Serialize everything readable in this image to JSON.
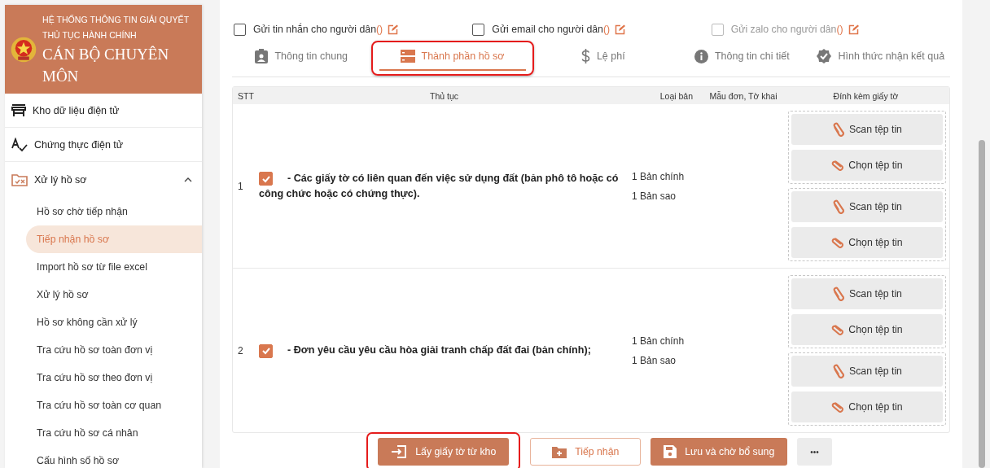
{
  "header": {
    "system_title": "HỆ THỐNG THÔNG TIN GIẢI QUYẾT THỦ TỤC HÀNH CHÍNH",
    "role": "CÁN BỘ CHUYÊN MÔN"
  },
  "sidebar": {
    "items": [
      {
        "kind": "link",
        "label": "Kho dữ liệu điện tử"
      },
      {
        "kind": "link",
        "label": "Chứng thực điện tử"
      },
      {
        "kind": "group",
        "label": "Xử lý hồ sơ",
        "expanded": true,
        "children": [
          {
            "label": "Hồ sơ chờ tiếp nhận",
            "selected": false
          },
          {
            "label": "Tiếp nhận hồ sơ",
            "selected": true
          },
          {
            "label": "Import hồ sơ từ file excel",
            "selected": false
          },
          {
            "label": "Xử lý hồ sơ",
            "selected": false
          },
          {
            "label": "Hồ sơ không cần xử lý",
            "selected": false
          },
          {
            "label": "Tra cứu hồ sơ toàn đơn vị",
            "selected": false
          },
          {
            "label": "Tra cứu hồ sơ theo đơn vị",
            "selected": false
          },
          {
            "label": "Tra cứu hồ sơ toàn cơ quan",
            "selected": false
          },
          {
            "label": "Tra cứu hồ sơ cá nhân",
            "selected": false
          },
          {
            "label": "Cấu hình số hồ sơ",
            "selected": false
          }
        ]
      }
    ]
  },
  "notifications": [
    {
      "label": "Gửi tin nhắn cho người dân",
      "suffix": "()",
      "checked": false,
      "disabled": false
    },
    {
      "label": "Gửi email cho người dân",
      "suffix": "()",
      "checked": false,
      "disabled": false
    },
    {
      "label": "Gửi zalo cho người dân",
      "suffix": "()",
      "checked": false,
      "disabled": true
    }
  ],
  "tabs": [
    {
      "label": "Thông tin chung",
      "selected": false
    },
    {
      "label": "Thành phần hồ sơ",
      "selected": true,
      "highlighted": true
    },
    {
      "label": "Lệ phí",
      "selected": false
    },
    {
      "label": "Thông tin chi tiết",
      "selected": false
    },
    {
      "label": "Hình thức nhận kết quả",
      "selected": false
    }
  ],
  "table": {
    "columns": [
      "STT",
      "Thủ tục",
      "Loại bản",
      "Mẫu đơn, Tờ khai",
      "Đính kèm giấy tờ"
    ],
    "rows": [
      {
        "stt": "1",
        "checked": true,
        "description": "- Các giấy tờ có liên quan đến việc sử dụng đất (bản phô tô hoặc có công chức hoặc có chứng thực).",
        "copies": [
          "1 Bản chính",
          "1 Bản sao"
        ],
        "attachments": [
          {
            "scan": "Scan tệp tin",
            "choose": "Chọn tệp tin"
          },
          {
            "scan": "Scan tệp tin",
            "choose": "Chọn tệp tin"
          }
        ]
      },
      {
        "stt": "2",
        "checked": true,
        "description": "- Đơn yêu cầu yêu cầu hòa giải tranh chấp đất đai (bản chính);",
        "copies": [
          "1 Bản chính",
          "1 Bản sao"
        ],
        "attachments": [
          {
            "scan": "Scan tệp tin",
            "choose": "Chọn tệp tin"
          },
          {
            "scan": "Scan tệp tin",
            "choose": "Chọn tệp tin"
          }
        ]
      }
    ]
  },
  "actions": [
    {
      "kind": "filled",
      "label": "Lấy giấy tờ từ kho",
      "highlighted": true
    },
    {
      "kind": "outline",
      "label": "Tiếp nhận"
    },
    {
      "kind": "filled",
      "label": "Lưu và chờ bổ sung"
    },
    {
      "kind": "more",
      "label": "•••"
    }
  ]
}
